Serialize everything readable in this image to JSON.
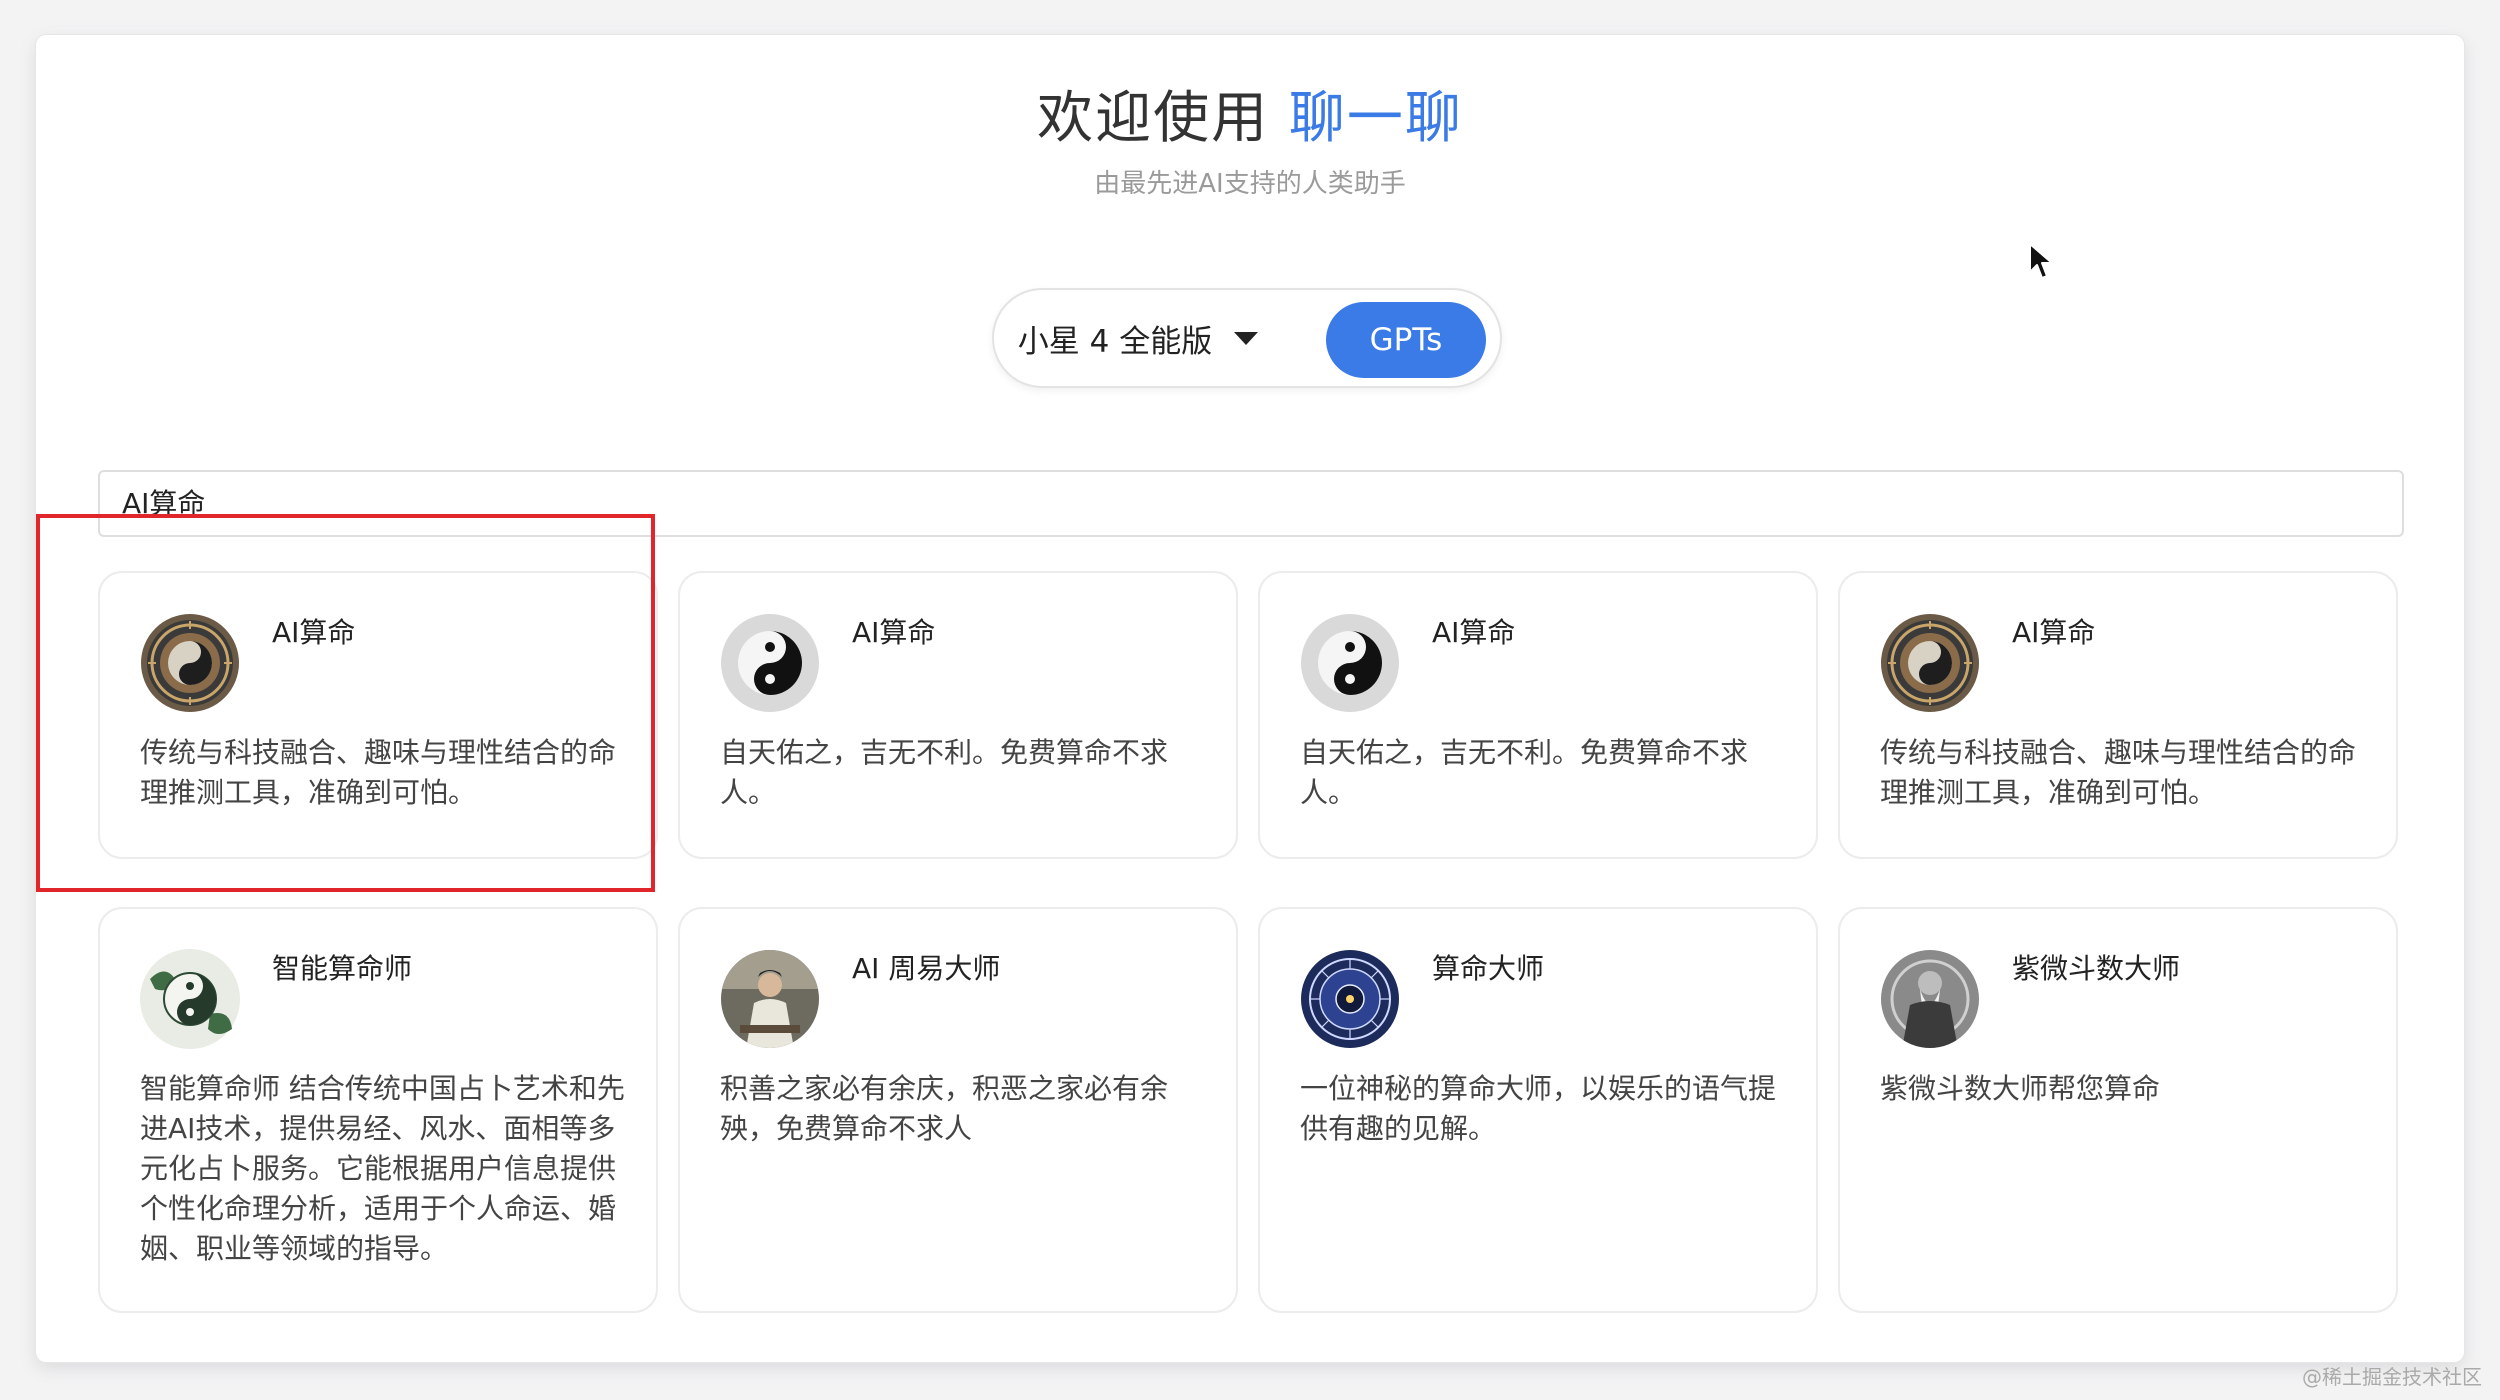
{
  "header": {
    "title_prefix": "欢迎使用",
    "title_brand": "聊一聊",
    "subtitle": "由最先进AI支持的人类助手"
  },
  "model_switch": {
    "selected_model": "小星 4 全能版",
    "gpts_label": "GPTs"
  },
  "search": {
    "value": "AI算命"
  },
  "cards": [
    {
      "name": "AI算命",
      "description": "传统与科技融合、趣味与理性结合的命理推测工具，准确到可怕。",
      "avatar": "compass-icon"
    },
    {
      "name": "AI算命",
      "description": "自天佑之，吉无不利。免费算命不求人。",
      "avatar": "yin-yang-icon"
    },
    {
      "name": "AI算命",
      "description": "自天佑之，吉无不利。免费算命不求人。",
      "avatar": "yin-yang-icon"
    },
    {
      "name": "AI算命",
      "description": "传统与科技融合、趣味与理性结合的命理推测工具，准确到可怕。",
      "avatar": "compass-icon"
    },
    {
      "name": "智能算命师",
      "description": "智能算命师 结合传统中国占卜艺术和先进AI技术，提供易经、风水、面相等多元化占卜服务。它能根据用户信息提供个性化命理分析，适用于个人命运、婚姻、职业等领域的指导。",
      "avatar": "yin-yang-painting-icon"
    },
    {
      "name": "AI 周易大师",
      "description": "积善之家必有余庆，积恶之家必有余殃，免费算命不求人",
      "avatar": "scholar-portrait-icon"
    },
    {
      "name": "算命大师",
      "description": "一位神秘的算命大师，以娱乐的语气提供有趣的见解。",
      "avatar": "zodiac-wheel-icon"
    },
    {
      "name": "紫微斗数大师",
      "description": "紫微斗数大师帮您算命",
      "avatar": "sage-portrait-icon"
    }
  ],
  "watermark": "@稀土掘金技术社区",
  "colors": {
    "accent": "#3a7be6",
    "button": "#3b7be8",
    "highlight": "#e0262a"
  }
}
